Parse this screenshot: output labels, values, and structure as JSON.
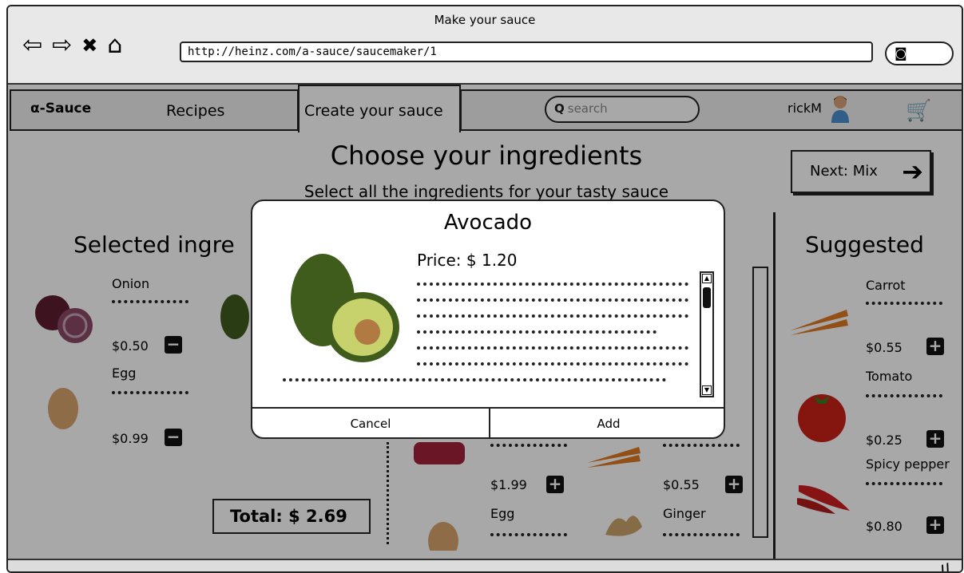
{
  "browser": {
    "title": "Make your sauce",
    "url": "http://heinz.com/a-sauce/saucemaker/1",
    "icons": [
      "back-icon",
      "forward-icon",
      "close-icon",
      "home-icon",
      "search-icon"
    ]
  },
  "nav": {
    "brand": "α-Sauce",
    "recipes": "Recipes",
    "create": "Create your sauce",
    "search_placeholder": "search",
    "user": "rickM"
  },
  "page": {
    "heading": "Choose your ingredients",
    "subheading": "Select all the ingredients for your tasty sauce",
    "next_label": "Next: Mix"
  },
  "selected": {
    "title": "Selected ingre",
    "items": [
      {
        "name": "Onion",
        "price": "$0.50"
      },
      {
        "name": "Egg",
        "price": "$0.99"
      }
    ],
    "total": "Total: $ 2.69"
  },
  "middle": {
    "items": [
      {
        "price": "$1.99"
      },
      {
        "price": "$0.55"
      },
      {
        "name": "Egg"
      },
      {
        "name": "Ginger"
      }
    ]
  },
  "suggested": {
    "title": "Suggested",
    "items": [
      {
        "name": "Carrot",
        "price": "$0.55"
      },
      {
        "name": "Tomato",
        "price": "$0.25"
      },
      {
        "name": "Spicy pepper",
        "price": "$0.80"
      }
    ]
  },
  "modal": {
    "title": "Avocado",
    "price": "Price: $ 1.20",
    "cancel": "Cancel",
    "add": "Add"
  },
  "colors": {
    "overlay": "#000000",
    "accent": "#222222",
    "avocado_green": "#3f5c1d",
    "tomato_red": "#c82018",
    "carrot_orange": "#e07a22"
  }
}
